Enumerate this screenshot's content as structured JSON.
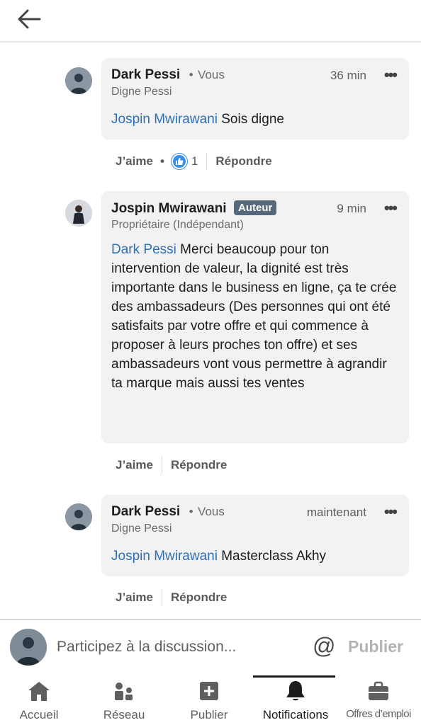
{
  "comments": [
    {
      "name": "Dark Pessi",
      "sep": "•",
      "you_label": "Vous",
      "time": "36 min",
      "subtitle": "Digne Pessi",
      "mention": "Jospin Mwirawani",
      "text": " Sois digne",
      "like_label": "J’aime",
      "like_count": "1",
      "reply_label": "Répondre"
    },
    {
      "name": "Jospin Mwirawani",
      "badge": "Auteur",
      "time": "9 min",
      "subtitle": "Propriétaire (Indépendant)",
      "mention": "Dark Pessi",
      "text": " Merci beaucoup pour ton intervention de valeur, la dignité est très importante dans le business en ligne, ça te crée des ambassadeurs (Des personnes qui ont été satisfaits par votre offre et qui commence à proposer à leurs proches ton offre) et ses ambassadeurs vont vous permettre à agrandir ta marque mais aussi tes ventes",
      "like_label": "J’aime",
      "reply_label": "Répondre"
    },
    {
      "name": "Dark Pessi",
      "sep": "•",
      "you_label": "Vous",
      "time": "maintenant",
      "subtitle": "Digne Pessi",
      "mention": "Jospin Mwirawani",
      "text": " Masterclass Akhy",
      "like_label": "J’aime",
      "reply_label": "Répondre"
    }
  ],
  "composer": {
    "placeholder": "Participez à la discussion...",
    "at_symbol": "@",
    "publish_label": "Publier"
  },
  "tabs": [
    {
      "label": "Accueil",
      "icon": "home-icon"
    },
    {
      "label": "Réseau",
      "icon": "network-icon"
    },
    {
      "label": "Publier",
      "icon": "plus-square-icon"
    },
    {
      "label": "Notifications",
      "icon": "bell-icon",
      "active": true
    },
    {
      "label": "Offres d’emploi",
      "icon": "briefcase-icon"
    }
  ],
  "colors": {
    "link": "#2f6fb3",
    "bubble": "#f2f2f2",
    "badge": "#56687a",
    "like": "#378fe9"
  }
}
